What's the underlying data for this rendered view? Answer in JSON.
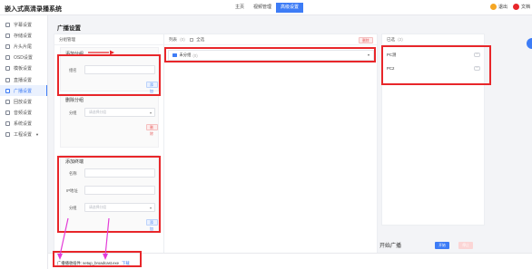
{
  "app": {
    "title": "嵌入式高清录播系统"
  },
  "topnav": [
    {
      "label": "主页",
      "active": false
    },
    {
      "label": "视频管理",
      "active": false
    },
    {
      "label": "高级设置",
      "active": true
    }
  ],
  "topright": {
    "user_label": "退出",
    "lang_label": "文档"
  },
  "sidebar": [
    {
      "label": "字幕设置",
      "icon": "subtitle-icon",
      "active": false
    },
    {
      "label": "存储设置",
      "icon": "storage-icon",
      "active": false
    },
    {
      "label": "片头片尾",
      "icon": "film-icon",
      "active": false
    },
    {
      "label": "OSD设置",
      "icon": "osd-icon",
      "active": false
    },
    {
      "label": "模板设置",
      "icon": "template-icon",
      "active": false
    },
    {
      "label": "直播设置",
      "icon": "live-icon",
      "active": false
    },
    {
      "label": "广播设置",
      "icon": "broadcast-icon",
      "active": true
    },
    {
      "label": "回放设置",
      "icon": "replay-icon",
      "active": false
    },
    {
      "label": "音频设置",
      "icon": "audio-icon",
      "active": false
    },
    {
      "label": "系统设置",
      "icon": "system-icon",
      "active": false
    },
    {
      "label": "工程设置",
      "icon": "engineering-icon",
      "active": false,
      "has_caret": true
    }
  ],
  "page": {
    "title": "广播设置"
  },
  "group_card": {
    "head": "分组管理",
    "add_group": {
      "title": "添加分组",
      "name_label": "组名",
      "confirm": "添加"
    },
    "delete_group": {
      "title": "删除分组",
      "group_label": "分组",
      "placeholder": "请选择分组",
      "confirm": "删除"
    },
    "add_terminal": {
      "title": "添加终端",
      "name_label": "名称",
      "ip_label": "IP地址",
      "group_label": "分组",
      "placeholder": "请选择分组",
      "confirm": "添加"
    }
  },
  "list_card": {
    "head_label": "列表",
    "head_count": "(0)",
    "head_check": "全选",
    "delete_btn": "删除",
    "row_label": "未分组",
    "row_count": "(0)"
  },
  "selected_card": {
    "head_label": "已选",
    "head_count": "(2)",
    "items": [
      "PC测",
      "PC2"
    ]
  },
  "footer": {
    "plugin_text": "广播播收插件: setup_broadcast.exe",
    "plugin_link": "下载",
    "start_label": "开始广播",
    "start_btn": "开始",
    "stop_btn": "停止"
  },
  "colors": {
    "accent": "#3d7cf6",
    "annotation_red": "#e8262a",
    "annotation_arrow": "#e33bd7"
  }
}
